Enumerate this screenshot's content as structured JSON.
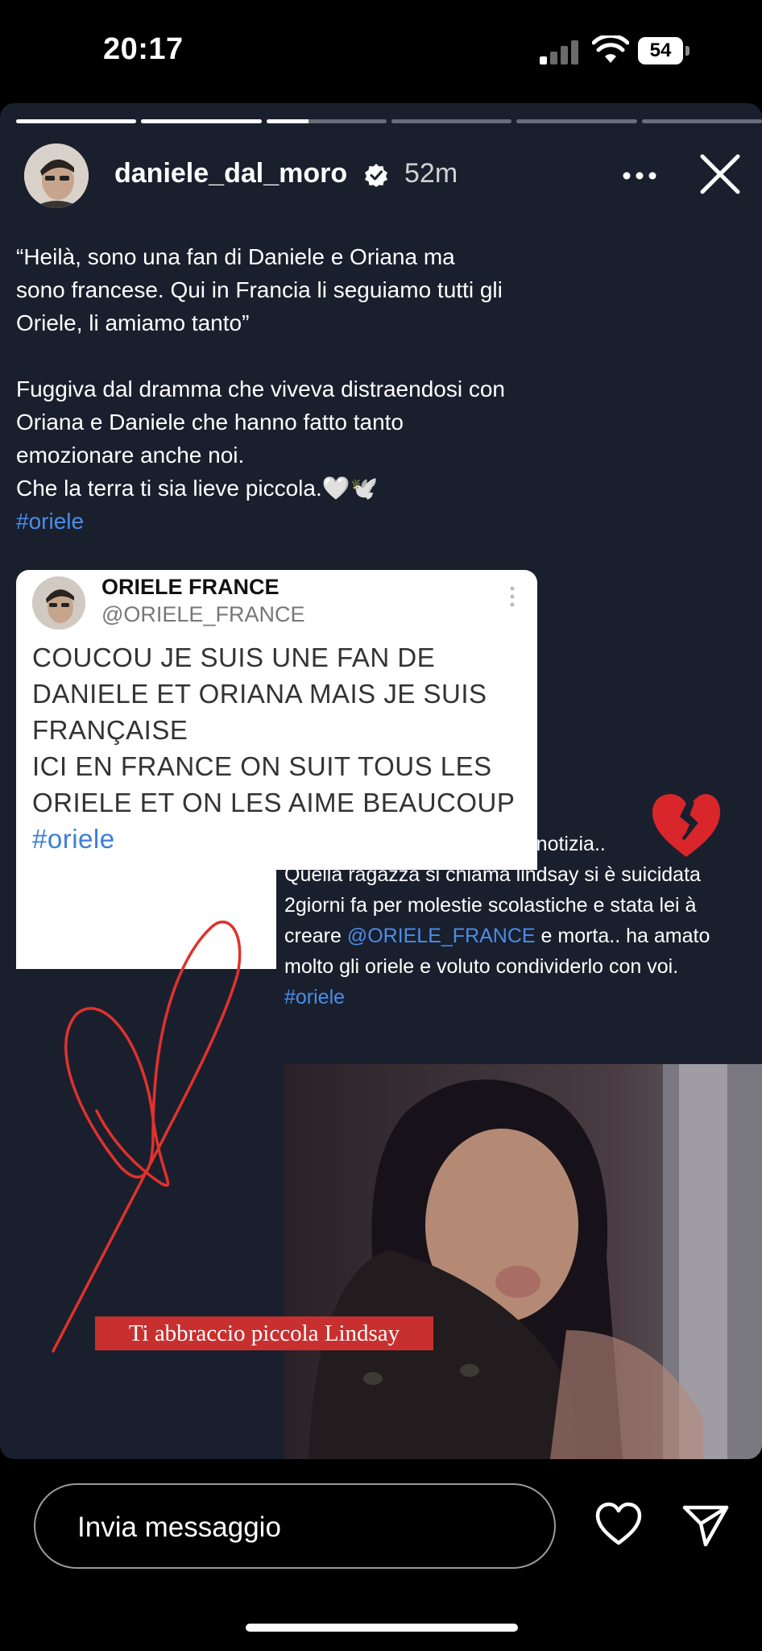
{
  "status_bar": {
    "time": "20:17",
    "battery": "54"
  },
  "story": {
    "progress": [
      1,
      1,
      0.35,
      0,
      0,
      0
    ],
    "user": {
      "username": "daniele_dal_moro",
      "verified": true,
      "time_ago": "52m"
    },
    "caption_quote": [
      "“Heilà, sono una fan di Daniele e Oriana ma",
      "sono francese. Qui in Francia li seguiamo tutti gli",
      "Oriele, li amiamo tanto”"
    ],
    "caption_body": [
      "Fuggiva dal dramma che viveva distraendosi con",
      "Oriana e Daniele che hanno fatto tanto",
      "emozionare anche noi.",
      "Che la terra ti sia lieve piccola.🤍🕊️"
    ],
    "caption_hashtag": "#oriele",
    "tweet": {
      "name": "ORIELE FRANCE",
      "handle": "@ORIELE_FRANCE",
      "lines": [
        "COUCOU JE SUIS UNE FAN DE",
        "DANIELE ET ORIANA MAIS JE SUIS",
        "FRANÇAISE",
        "ICI EN FRANCE ON SUIT TOUS LES",
        "ORIELE ET ON LES AIME BEAUCOUP"
      ],
      "hashtag": "#oriele"
    },
    "note": {
      "line1": "Allora ragazzi ho una brutta notizia..",
      "line2": "Quella ragazza si chiama lindsay si è suicidata",
      "line3": "2giorni fa per molestie scolastiche e stata lei à",
      "line4_pre": "creare ",
      "mention": "@ORIELE_FRANCE",
      "line4_post": " e morta.. ha amato",
      "line5": "molto gli oriele e voluto condividerlo con voi.",
      "hashtag": "#oriele"
    },
    "banner": "Ti abbraccio piccola Lindsay"
  },
  "footer": {
    "message_placeholder": "Invia messaggio"
  },
  "colors": {
    "story_bg": "#1a1f2e",
    "link": "#4a8ee8",
    "banner": "#c8302f",
    "heart_line": "#e0322c"
  }
}
